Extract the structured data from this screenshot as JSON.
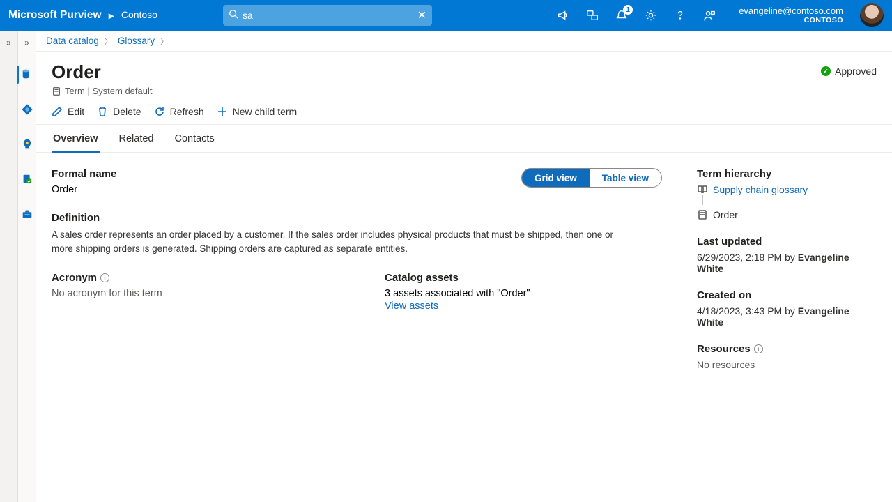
{
  "top": {
    "brand": "Microsoft Purview",
    "tenant_name": "Contoso",
    "search_value": "sa",
    "notification_badge": "1",
    "user_email": "evangeline@contoso.com",
    "user_tenant": "CONTOSO"
  },
  "breadcrumb": {
    "a": "Data catalog",
    "b": "Glossary"
  },
  "page": {
    "title": "Order",
    "subtitle": "Term | System default",
    "status": "Approved"
  },
  "cmd": {
    "edit": "Edit",
    "delete": "Delete",
    "refresh": "Refresh",
    "newchild": "New child term"
  },
  "tabs": {
    "overview": "Overview",
    "related": "Related",
    "contacts": "Contacts"
  },
  "view_toggle": {
    "grid": "Grid view",
    "table": "Table view"
  },
  "overview": {
    "formal_head": "Formal name",
    "formal_val": "Order",
    "definition_head": "Definition",
    "definition_body": "A sales order represents an order placed by a customer. If the sales order includes physical products that must be shipped, then one or more shipping orders is generated. Shipping orders are captured as separate entities.",
    "acronym_head": "Acronym",
    "acronym_val": "No acronym for this term",
    "assets_head": "Catalog assets",
    "assets_val": "3 assets associated with \"Order\"",
    "view_assets": "View assets"
  },
  "side": {
    "hier_head": "Term hierarchy",
    "hier_parent": "Supply chain glossary",
    "hier_self": "Order",
    "lastup_head": "Last updated",
    "lastup_ts": "6/29/2023, 2:18 PM by ",
    "lastup_user": "Evangeline White",
    "created_head": "Created on",
    "created_ts": "4/18/2023, 3:43 PM by ",
    "created_user": "Evangeline White",
    "res_head": "Resources",
    "res_val": "No resources"
  }
}
